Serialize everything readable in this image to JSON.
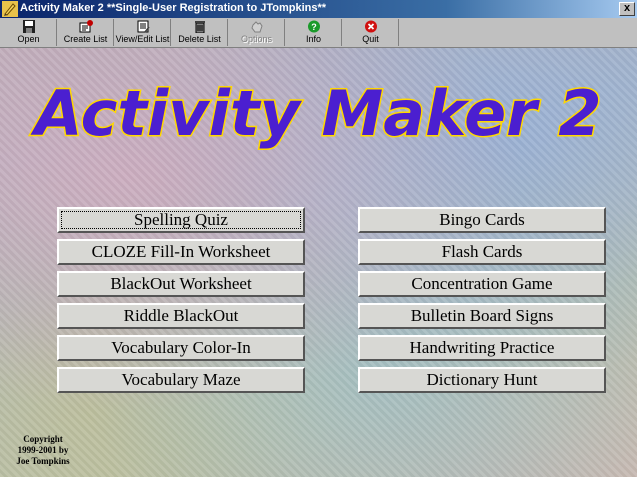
{
  "window": {
    "title": "Activity Maker 2 **Single-User Registration to JTompkins**",
    "close_glyph": "x"
  },
  "toolbar": {
    "items": [
      {
        "label": "Open",
        "icon": "floppy-disk-icon"
      },
      {
        "label": "Create List",
        "icon": "create-list-icon"
      },
      {
        "label": "View/Edit List",
        "icon": "view-edit-list-icon"
      },
      {
        "label": "Delete List",
        "icon": "delete-list-icon"
      },
      {
        "label": "Options",
        "icon": "options-hand-icon"
      },
      {
        "label": "Info",
        "icon": "info-question-icon"
      },
      {
        "label": "Quit",
        "icon": "quit-x-icon"
      }
    ]
  },
  "logo": {
    "text": "Activity Maker 2",
    "fill_color": "#4b1fd0",
    "outline_color": "#ffd800"
  },
  "activities": {
    "left": [
      "Spelling Quiz",
      "CLOZE Fill-In Worksheet",
      "BlackOut Worksheet",
      "Riddle BlackOut",
      "Vocabulary Color-In",
      "Vocabulary Maze"
    ],
    "right": [
      "Bingo Cards",
      "Flash Cards",
      "Concentration Game",
      "Bulletin Board Signs",
      "Handwriting Practice",
      "Dictionary Hunt"
    ]
  },
  "copyright": {
    "line1": "Copyright",
    "line2": "1999-2001 by",
    "line3": "Joe Tompkins"
  }
}
